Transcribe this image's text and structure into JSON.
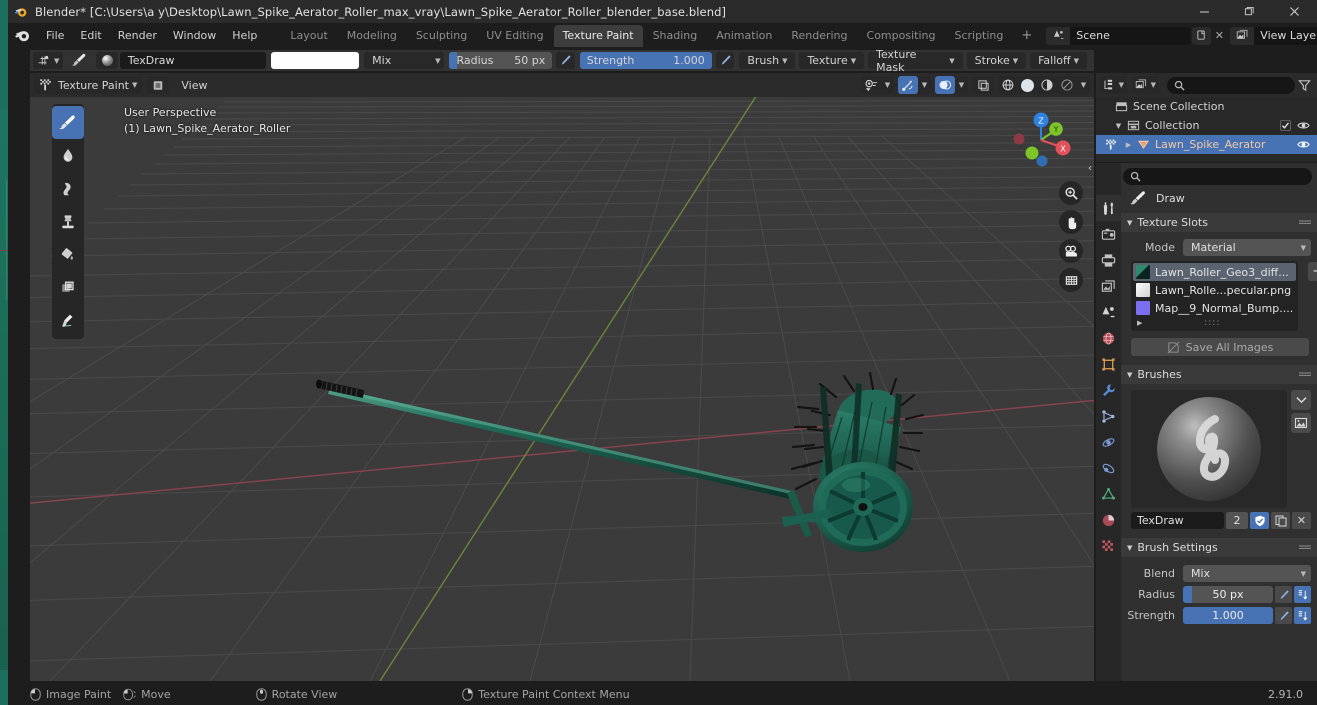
{
  "window": {
    "title": "Blender* [C:\\Users\\a y\\Desktop\\Lawn_Spike_Aerator_Roller_max_vray\\Lawn_Spike_Aerator_Roller_blender_base.blend]",
    "minimize": "–",
    "maximize": "❐",
    "close": "✕",
    "app_icon": "blender-logo-icon"
  },
  "topbar": {
    "menus": [
      "File",
      "Edit",
      "Render",
      "Window",
      "Help"
    ],
    "workspaces": [
      {
        "label": "Layout",
        "active": false
      },
      {
        "label": "Modeling",
        "active": false
      },
      {
        "label": "Sculpting",
        "active": false
      },
      {
        "label": "UV Editing",
        "active": false
      },
      {
        "label": "Texture Paint",
        "active": true
      },
      {
        "label": "Shading",
        "active": false
      },
      {
        "label": "Animation",
        "active": false
      },
      {
        "label": "Rendering",
        "active": false
      },
      {
        "label": "Compositing",
        "active": false
      },
      {
        "label": "Scripting",
        "active": false
      }
    ],
    "add_workspace": "+",
    "scene": {
      "icon": "scene-icon",
      "name": "Scene",
      "new_btn": "new-scene-icon",
      "unlink": "✕"
    },
    "view_layer": {
      "icon": "view-layer-icon",
      "name": "View Layer",
      "new_btn": "new-layer-icon",
      "unlink": "✕"
    }
  },
  "tool_settings": {
    "snap_icon": "brush-falloff-icon",
    "brush_icon": "paint-brush-icon",
    "brush_preview": "brush-sphere-preview",
    "brush_name": "TexDraw",
    "color": "#ffffff",
    "blend_mode": "Mix",
    "radius": {
      "label": "Radius",
      "value": "50 px",
      "fill_pct": 7
    },
    "radius_pressure_icon": "pressure-radius-icon",
    "strength": {
      "label": "Strength",
      "value": "1.000",
      "fill_pct": 100
    },
    "strength_pressure_icon": "pressure-strength-icon",
    "popovers": [
      "Brush",
      "Texture",
      "Texture Mask",
      "Stroke",
      "Falloff"
    ]
  },
  "viewport_header": {
    "mode_icon": "texture-paint-mode-icon",
    "mode": "Texture Paint",
    "canvas_icon": "canvas-image-icon",
    "menus": [
      "View"
    ],
    "overlay_icons": [
      "visibility-icon",
      "gizmo-icon",
      "overlays-icon",
      "xray-icon"
    ],
    "shading_modes": [
      "wireframe-icon",
      "solid-icon",
      "material-preview-icon",
      "rendered-icon"
    ],
    "shading_active": "solid-icon"
  },
  "viewport": {
    "perspective_label": "User Perspective",
    "object_label": "(1) Lawn_Spike_Aerator_Roller",
    "gizmo_axes": [
      {
        "axis": "Z",
        "color": "#2f83e0"
      },
      {
        "axis": "Y",
        "color": "#7dc628"
      },
      {
        "axis": "X",
        "color": "#e3515a"
      }
    ],
    "nav_buttons": [
      "zoom-icon",
      "pan-hand-icon",
      "camera-view-icon",
      "orthographic-toggle-icon"
    ],
    "region_toggle": "‹",
    "model_color": "#1d6352",
    "grid_color": "#4a4a4a",
    "x_axis_line_color": "#8a3b46",
    "y_axis_line_color": "#6e8a3b",
    "background": "#3b3b3b"
  },
  "tool_shelf": [
    {
      "name": "draw-tool",
      "icon": "paint-brush-icon",
      "active": true
    },
    {
      "name": "soften-tool",
      "icon": "soften-drop-icon",
      "active": false
    },
    {
      "name": "smear-tool",
      "icon": "smear-icon",
      "active": false
    },
    {
      "name": "clone-tool",
      "icon": "clone-stamp-icon",
      "active": false
    },
    {
      "name": "fill-tool",
      "icon": "paint-bucket-icon",
      "active": false
    },
    {
      "name": "mask-tool",
      "icon": "mask-icon",
      "active": false
    },
    {
      "name": "annotate-tool",
      "icon": "annotate-pen-icon",
      "active": false
    }
  ],
  "outliner": {
    "header_icons": [
      "display-mode-icon",
      "filter-id-icon",
      "search-icon",
      "filter-funnel-icon"
    ],
    "rows": [
      {
        "indent": 0,
        "tri": "",
        "icon": "scene-collection-icon",
        "label": "Scene Collection",
        "checkbox": false,
        "eye": false,
        "selected": false
      },
      {
        "indent": 1,
        "tri": "▼",
        "icon": "collection-icon",
        "label": "Collection",
        "checkbox": true,
        "eye": true,
        "selected": false
      },
      {
        "indent": 2,
        "tri": "▶",
        "icon": "mesh-object-icon",
        "label": "Lawn_Spike_Aerator",
        "checkbox": false,
        "eye": true,
        "selected": true
      }
    ]
  },
  "properties": {
    "tabs": [
      {
        "name": "tool-tab",
        "icon": "tool-wrench-screwdriver-icon",
        "active": true
      },
      {
        "name": "render-tab",
        "icon": "camera-back-icon",
        "active": false
      },
      {
        "name": "output-tab",
        "icon": "printer-icon",
        "active": false
      },
      {
        "name": "view-layer-tab",
        "icon": "images-icon",
        "active": false
      },
      {
        "name": "scene-tab",
        "icon": "scene-cone-icon",
        "active": false
      },
      {
        "name": "world-tab",
        "icon": "world-globe-icon",
        "active": false
      },
      {
        "name": "object-tab",
        "icon": "object-square-icon",
        "active": false
      },
      {
        "name": "modifier-tab",
        "icon": "wrench-icon",
        "active": false
      },
      {
        "name": "particles-tab",
        "icon": "particles-icon",
        "active": false
      },
      {
        "name": "physics-tab",
        "icon": "physics-orbit-icon",
        "active": false
      },
      {
        "name": "constraints-tab",
        "icon": "constraint-icon",
        "active": false
      },
      {
        "name": "data-tab",
        "icon": "mesh-data-triangle-icon",
        "active": false
      },
      {
        "name": "material-tab",
        "icon": "material-sphere-icon",
        "active": false
      },
      {
        "name": "texture-tab",
        "icon": "texture-checker-icon",
        "active": false
      }
    ],
    "search_placeholder": "",
    "active_tool": {
      "icon": "paint-brush-icon",
      "name": "Draw"
    },
    "texture_slots": {
      "title": "Texture Slots",
      "mode_label": "Mode",
      "mode_value": "Material",
      "add_button": "+",
      "slots": [
        {
          "swatch": "#1e6a58",
          "name": "Lawn_Roller_Geo3_diff...",
          "selected": true
        },
        {
          "swatch": "#e8e8e8",
          "name": "Lawn_Rolle...pecular.png",
          "selected": false
        },
        {
          "swatch": "#7a6ff0",
          "name": "Map__9_Normal_Bump....",
          "selected": false
        }
      ],
      "expand_tri": "▶",
      "grip": "::::",
      "save_all_label": "Save All Images",
      "save_all_icon": "save-disabled-icon"
    },
    "brushes": {
      "title": "Brushes",
      "preview": "brush-sphere-big-preview",
      "side_buttons": [
        "chevron-down-icon",
        "image-browse-icon"
      ],
      "brush_name": "TexDraw",
      "users_count": "2",
      "fake_user_icon": "shield-icon",
      "duplicate_icon": "copy-icon",
      "unlink_icon": "✕"
    },
    "brush_settings": {
      "title": "Brush Settings",
      "blend_label": "Blend",
      "blend_value": "Mix",
      "radius_label": "Radius",
      "radius_value": "50 px",
      "radius_fill_pct": 10,
      "strength_label": "Strength",
      "strength_value": "1.000",
      "strength_fill_pct": 100,
      "pressure_icon": "pressure-pen-icon",
      "unified_icon": "unified-settings-icon"
    }
  },
  "status_bar": {
    "items": [
      {
        "icon": "mouse-left-icon",
        "label": "Image Paint"
      },
      {
        "icon": "mouse-move-icon",
        "label": "Move"
      },
      {
        "icon": "mouse-middle-icon",
        "label": "Rotate View"
      },
      {
        "icon": "mouse-right-icon",
        "label": "Texture Paint Context Menu"
      }
    ],
    "version": "2.91.0"
  },
  "colors": {
    "accent_blue": "#4772b3",
    "panel_bg": "#303030",
    "header_bg": "#2b2b2b",
    "viewport_bg": "#3b3b3b",
    "window_bg": "#1d1d1d",
    "field_bg": "#545454",
    "text": "#d5d5d5"
  }
}
